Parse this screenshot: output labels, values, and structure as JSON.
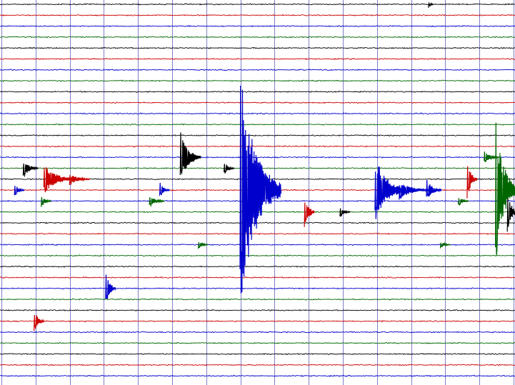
{
  "helicorder": {
    "trace_count": 35,
    "trace_colors": [
      "#000000",
      "#cc0000",
      "#0000cc",
      "#006600"
    ],
    "gridline_color": "#4a4ab0",
    "background": "#ffffff",
    "vertical_gridline_count": 15,
    "events": [
      {
        "trace": 15,
        "pos": 0.045,
        "color": "#000000",
        "amp": 14,
        "len": 0.03
      },
      {
        "trace": 16,
        "pos": 0.085,
        "color": "#cc0000",
        "amp": 22,
        "len": 0.06
      },
      {
        "trace": 16,
        "pos": 0.135,
        "color": "#cc0000",
        "amp": 9,
        "len": 0.04
      },
      {
        "trace": 17,
        "pos": 0.028,
        "color": "#0000cc",
        "amp": 10,
        "len": 0.02
      },
      {
        "trace": 18,
        "pos": 0.08,
        "color": "#006600",
        "amp": 9,
        "len": 0.02
      },
      {
        "trace": 14,
        "pos": 0.35,
        "color": "#000000",
        "amp": 38,
        "len": 0.04
      },
      {
        "trace": 17,
        "pos": 0.31,
        "color": "#0000cc",
        "amp": 12,
        "len": 0.02
      },
      {
        "trace": 18,
        "pos": 0.29,
        "color": "#006600",
        "amp": 9,
        "len": 0.03
      },
      {
        "trace": 15,
        "pos": 0.435,
        "color": "#000000",
        "amp": 10,
        "len": 0.02
      },
      {
        "trace": 17,
        "pos": 0.466,
        "color": "#0000cc",
        "amp": 170,
        "len": 0.08
      },
      {
        "trace": 19,
        "pos": 0.591,
        "color": "#cc0000",
        "amp": 28,
        "len": 0.02
      },
      {
        "trace": 19,
        "pos": 0.66,
        "color": "#000000",
        "amp": 8,
        "len": 0.02
      },
      {
        "trace": 17,
        "pos": 0.728,
        "color": "#0000cc",
        "amp": 50,
        "len": 0.06
      },
      {
        "trace": 17,
        "pos": 0.775,
        "color": "#0000cc",
        "amp": 14,
        "len": 0.06
      },
      {
        "trace": 17,
        "pos": 0.828,
        "color": "#0000cc",
        "amp": 16,
        "len": 0.03
      },
      {
        "trace": 16,
        "pos": 0.907,
        "color": "#cc0000",
        "amp": 30,
        "len": 0.02
      },
      {
        "trace": 18,
        "pos": 0.89,
        "color": "#006600",
        "amp": 8,
        "len": 0.02
      },
      {
        "trace": 14,
        "pos": 0.94,
        "color": "#006600",
        "amp": 10,
        "len": 0.03
      },
      {
        "trace": 17,
        "pos": 0.962,
        "color": "#006600",
        "amp": 120,
        "len": 0.04
      },
      {
        "trace": 19,
        "pos": 0.985,
        "color": "#000000",
        "amp": 30,
        "len": 0.02
      },
      {
        "trace": 26,
        "pos": 0.205,
        "color": "#0000cc",
        "amp": 28,
        "len": 0.02
      },
      {
        "trace": 29,
        "pos": 0.066,
        "color": "#cc0000",
        "amp": 18,
        "len": 0.02
      },
      {
        "trace": 22,
        "pos": 0.385,
        "color": "#006600",
        "amp": 6,
        "len": 0.02
      },
      {
        "trace": 22,
        "pos": 0.855,
        "color": "#006600",
        "amp": 6,
        "len": 0.02
      },
      {
        "trace": 0,
        "pos": 0.832,
        "color": "#000000",
        "amp": 6,
        "len": 0.01
      }
    ]
  }
}
